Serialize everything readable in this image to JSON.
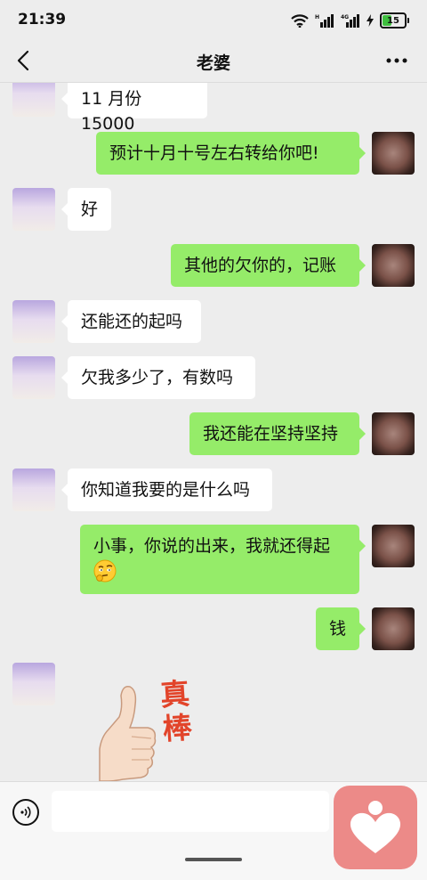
{
  "status_bar": {
    "time": "21:39",
    "battery": "15"
  },
  "header": {
    "title": "老婆"
  },
  "messages": [
    {
      "side": "left",
      "text": "11 月份 15000"
    },
    {
      "side": "right",
      "text": "预计十月十号左右转给你吧!"
    },
    {
      "side": "left",
      "text": "好"
    },
    {
      "side": "right",
      "text": "其他的欠你的，记账"
    },
    {
      "side": "left",
      "text": "还能还的起吗"
    },
    {
      "side": "left",
      "text": "欠我多少了，有数吗"
    },
    {
      "side": "right",
      "text": "我还能在坚持坚持"
    },
    {
      "side": "left",
      "text": "你知道我要的是什么吗"
    },
    {
      "side": "right",
      "text": "小事，你说的出来，我就还得起",
      "emoji": "thinking-face"
    },
    {
      "side": "right",
      "text": "钱"
    },
    {
      "side": "left",
      "type": "sticker",
      "sticker": {
        "icon": "thumbs-up",
        "text": "真棒"
      }
    }
  ],
  "input": {
    "value": ""
  },
  "colors": {
    "background": "#ededed",
    "bubble_right": "#95ec69",
    "bubble_left": "#ffffff",
    "app_icon": "#ec8a88",
    "sticker_text": "#e2442a"
  }
}
